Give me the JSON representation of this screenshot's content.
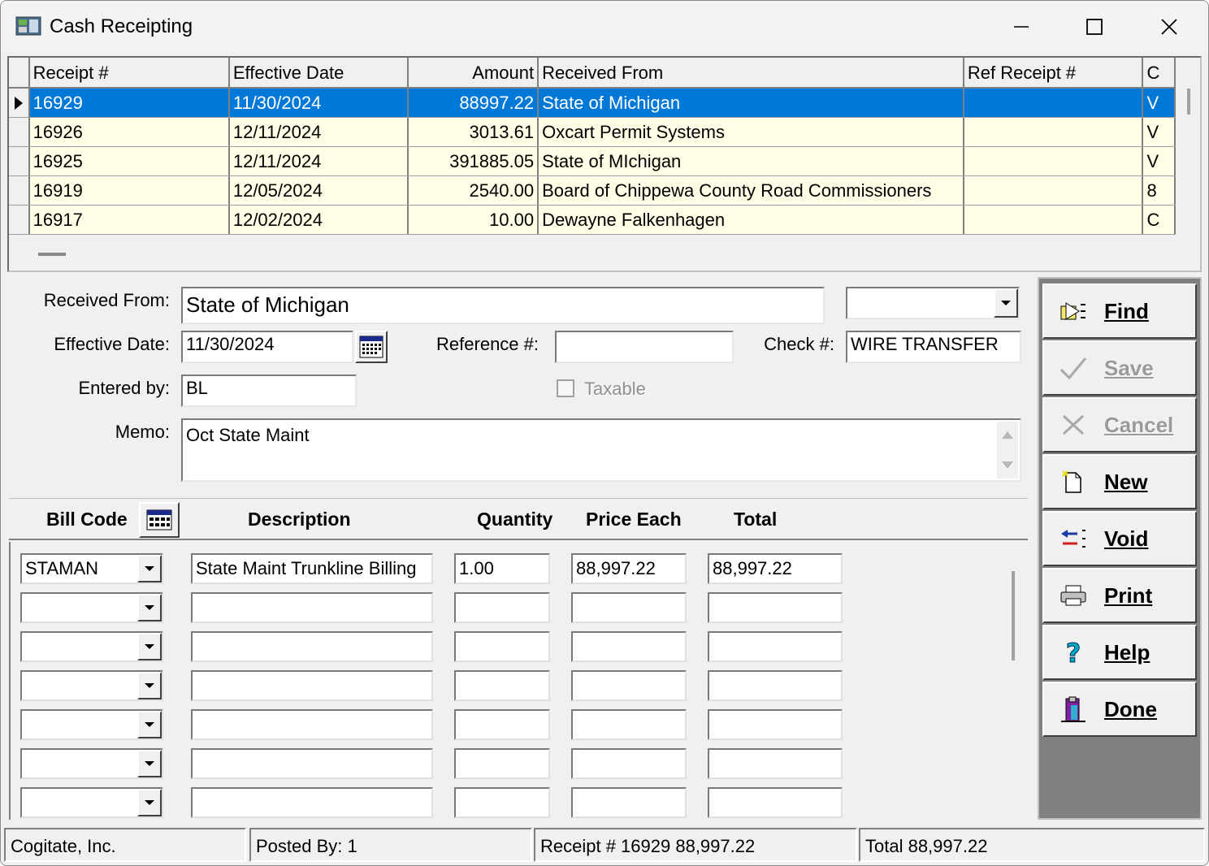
{
  "window": {
    "title": "Cash Receipting"
  },
  "grid": {
    "columns": [
      "Receipt #",
      "Effective Date",
      "Amount",
      "Received From",
      "Ref Receipt #",
      "C"
    ],
    "rows": [
      {
        "receipt": "16929",
        "date": "11/30/2024",
        "amount": "88997.22",
        "from": "State of Michigan",
        "ref": "",
        "c": "V"
      },
      {
        "receipt": "16926",
        "date": "12/11/2024",
        "amount": "3013.61",
        "from": "Oxcart Permit Systems",
        "ref": "",
        "c": "V"
      },
      {
        "receipt": "16925",
        "date": "12/11/2024",
        "amount": "391885.05",
        "from": "State of MIchigan",
        "ref": "",
        "c": "V"
      },
      {
        "receipt": "16919",
        "date": "12/05/2024",
        "amount": "2540.00",
        "from": "Board of Chippewa County Road Commissioners",
        "ref": "",
        "c": "8"
      },
      {
        "receipt": "16917",
        "date": "12/02/2024",
        "amount": "10.00",
        "from": "Dewayne Falkenhagen",
        "ref": "",
        "c": "C"
      }
    ]
  },
  "form": {
    "received_from_label": "Received From:",
    "received_from_value": "State of Michigan",
    "effective_date_label": "Effective Date:",
    "effective_date_value": "11/30/2024",
    "reference_label": "Reference #:",
    "reference_value": "",
    "check_label": "Check #:",
    "check_value": "WIRE TRANSFER",
    "entered_by_label": "Entered by:",
    "entered_by_value": "BL",
    "taxable_label": "Taxable",
    "memo_label": "Memo:",
    "memo_value": "Oct State Maint"
  },
  "buttons": {
    "find": "Find",
    "save": "Save",
    "cancel": "Cancel",
    "new": "New",
    "void": "Void",
    "print": "Print",
    "help": "Help",
    "done": "Done"
  },
  "billing": {
    "headers": {
      "bill_code": "Bill Code",
      "description": "Description",
      "quantity": "Quantity",
      "price_each": "Price Each",
      "total": "Total"
    },
    "lines": [
      {
        "code": "STAMAN",
        "description": "State Maint Trunkline Billing",
        "quantity": "1.00",
        "price": "88,997.22",
        "total": "88,997.22"
      },
      {
        "code": "",
        "description": "",
        "quantity": "",
        "price": "",
        "total": ""
      },
      {
        "code": "",
        "description": "",
        "quantity": "",
        "price": "",
        "total": ""
      },
      {
        "code": "",
        "description": "",
        "quantity": "",
        "price": "",
        "total": ""
      },
      {
        "code": "",
        "description": "",
        "quantity": "",
        "price": "",
        "total": ""
      },
      {
        "code": "",
        "description": "",
        "quantity": "",
        "price": "",
        "total": ""
      },
      {
        "code": "",
        "description": "",
        "quantity": "",
        "price": "",
        "total": ""
      }
    ]
  },
  "status": {
    "company": "Cogitate, Inc.",
    "posted_by": "Posted By: 1",
    "receipt": "Receipt # 16929 88,997.22",
    "total": "Total  88,997.22"
  },
  "colors": {
    "selection": "#0078d7",
    "row_background": "#fffee6",
    "button_column": "#808080"
  }
}
